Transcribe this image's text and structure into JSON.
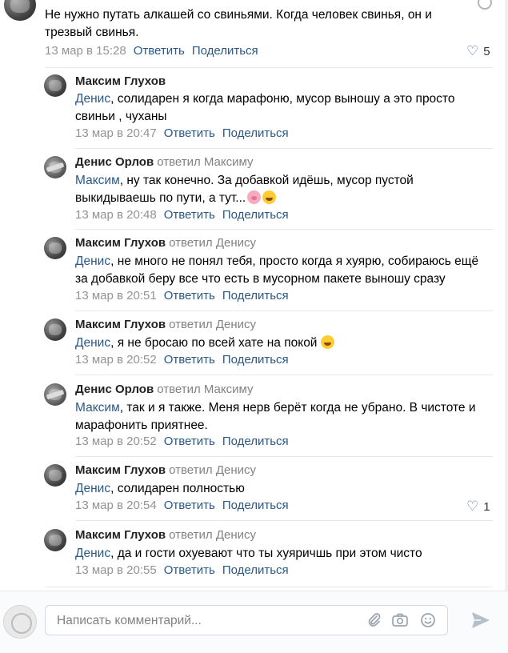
{
  "comments": [
    {
      "author": "",
      "reply_to": "",
      "mention": "",
      "text": "Не нужно путать алкашей со свиньями. Когда человек свинья, он и трезвый свинья.",
      "date": "13 мар в 15:28",
      "likes": "5"
    },
    {
      "author": "Максим Глухов",
      "reply_to": "",
      "mention": "Денис",
      "text": ", солидарен я когда марафоню, мусор выношу а это просто свиньи , чуханы",
      "date": "13 мар в 20:47",
      "likes": ""
    },
    {
      "author": "Денис Орлов",
      "reply_to": "ответил Максиму",
      "mention": "Максим",
      "text": ", ну так конечно. За добавкой идёшь, мусор пустой выкидываешь по пути, а тут...",
      "date": "13 мар в 20:48",
      "likes": ""
    },
    {
      "author": "Максим Глухов",
      "reply_to": "ответил Денису",
      "mention": "Денис",
      "text": ", не много не понял тебя, просто когда я хуярю, собираюсь ещё за добавкой беру все что есть в мусорном пакете выношу сразу",
      "date": "13 мар в 20:51",
      "likes": ""
    },
    {
      "author": "Максим Глухов",
      "reply_to": "ответил Денису",
      "mention": "Денис",
      "text": ", я не бросаю по всей хате на покой",
      "date": "13 мар в 20:52",
      "likes": ""
    },
    {
      "author": "Денис Орлов",
      "reply_to": "ответил Максиму",
      "mention": "Максим",
      "text": ", так и я также. Меня нерв берёт когда не убрано. В чистоте и марафонить приятнее.",
      "date": "13 мар в 20:52",
      "likes": ""
    },
    {
      "author": "Максим Глухов",
      "reply_to": "ответил Денису",
      "mention": "Денис",
      "text": ", солидарен полностью",
      "date": "13 мар в 20:54",
      "likes": "1"
    },
    {
      "author": "Максим Глухов",
      "reply_to": "ответил Денису",
      "mention": "Денис",
      "text": ", да и гости охуевают что ты хуяричшь при этом чисто",
      "date": "13 мар в 20:55",
      "likes": ""
    }
  ],
  "actions": {
    "reply": "Ответить",
    "share": "Поделиться"
  },
  "composer": {
    "placeholder": "Написать комментарий..."
  },
  "icons": {
    "like": "heart-icon",
    "attach": "paperclip-icon",
    "camera": "camera-icon",
    "emoji": "smiley-icon",
    "send": "send-arrow-icon"
  },
  "colors": {
    "link": "#2a5885",
    "meta": "#939393",
    "author": "#222222",
    "heart": "#5a7ca7"
  }
}
